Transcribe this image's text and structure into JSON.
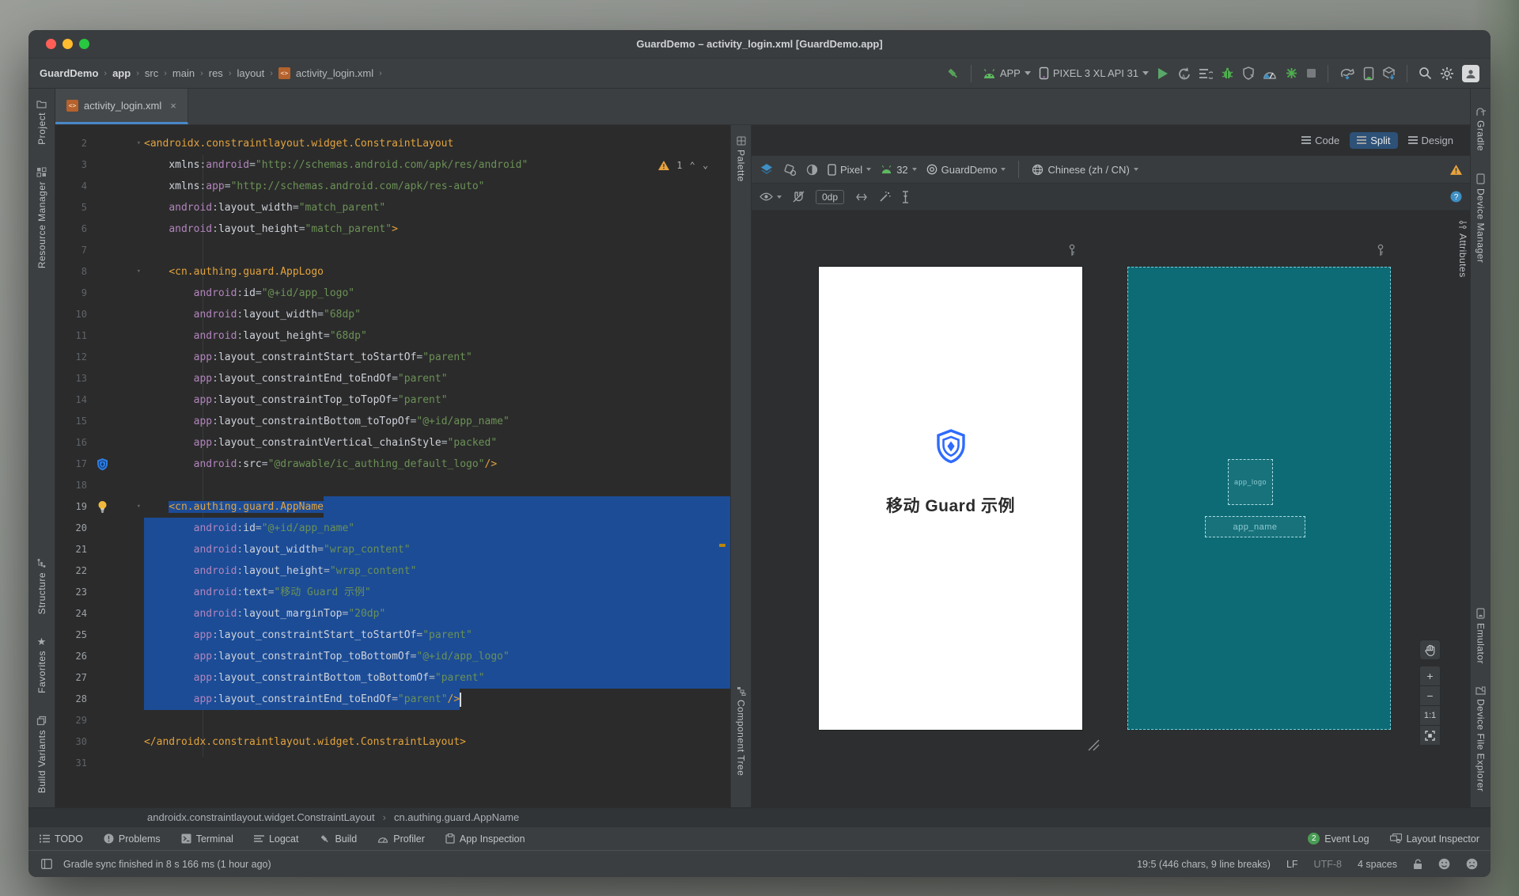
{
  "window": {
    "title": "GuardDemo – activity_login.xml [GuardDemo.app]"
  },
  "breadcrumb": {
    "items": [
      "GuardDemo",
      "app",
      "src",
      "main",
      "res",
      "layout",
      "activity_login.xml"
    ]
  },
  "toolbar": {
    "run_config": "APP",
    "device": "PIXEL 3 XL API 31",
    "action_icons": [
      "build-hammer",
      "android-head",
      "device-phone",
      "run",
      "apply-changes",
      "apply-code-changes",
      "debug",
      "profile",
      "profiler-gauge",
      "attach-debugger",
      "stop",
      "gradle-sync",
      "device-manager",
      "sdk-manager",
      "search",
      "settings",
      "avatar"
    ]
  },
  "tabs": {
    "active": "activity_login.xml"
  },
  "view_modes": {
    "code": "Code",
    "split": "Split",
    "design": "Design",
    "active": "Split"
  },
  "left_strip": {
    "top": [
      "Project",
      "Resource Manager"
    ],
    "bottom": [
      "Structure",
      "Favorites",
      "Build Variants"
    ]
  },
  "mid_strip": {
    "top": "Palette",
    "bottom": "Component Tree"
  },
  "right_strip": {
    "top": [
      "Gradle",
      "Device Manager"
    ],
    "bottom": [
      "Emulator",
      "Device File Explorer"
    ],
    "attributes_tab": "Attributes"
  },
  "editor": {
    "warning_count": "1",
    "selection_range": "lines 19-28",
    "lines": [
      {
        "n": "2",
        "sel": "none",
        "g": "fold",
        "t": [
          [
            "tag",
            "<androidx.constraintlayout.widget.ConstraintLayout"
          ]
        ]
      },
      {
        "n": "3",
        "sel": "none",
        "g": "",
        "t": [
          [
            "pln",
            "    "
          ],
          [
            "attr",
            "xmlns"
          ],
          [
            "pln",
            ":"
          ],
          [
            "ns",
            "android"
          ],
          [
            "pln",
            "="
          ],
          [
            "val",
            "\"http://schemas.android.com/apk/res/android\""
          ]
        ]
      },
      {
        "n": "4",
        "sel": "none",
        "g": "",
        "t": [
          [
            "pln",
            "    "
          ],
          [
            "attr",
            "xmlns"
          ],
          [
            "pln",
            ":"
          ],
          [
            "ns",
            "app"
          ],
          [
            "pln",
            "="
          ],
          [
            "val",
            "\"http://schemas.android.com/apk/res-auto\""
          ]
        ]
      },
      {
        "n": "5",
        "sel": "none",
        "g": "",
        "t": [
          [
            "pln",
            "    "
          ],
          [
            "ns",
            "android"
          ],
          [
            "pln",
            ":"
          ],
          [
            "attr",
            "layout_width"
          ],
          [
            "pln",
            "="
          ],
          [
            "val",
            "\"match_parent\""
          ]
        ]
      },
      {
        "n": "6",
        "sel": "none",
        "g": "",
        "t": [
          [
            "pln",
            "    "
          ],
          [
            "ns",
            "android"
          ],
          [
            "pln",
            ":"
          ],
          [
            "attr",
            "layout_height"
          ],
          [
            "pln",
            "="
          ],
          [
            "val",
            "\"match_parent\""
          ],
          [
            "tag",
            ">"
          ]
        ]
      },
      {
        "n": "7",
        "sel": "none",
        "g": "",
        "t": []
      },
      {
        "n": "8",
        "sel": "none",
        "g": "fold",
        "t": [
          [
            "pln",
            "    "
          ],
          [
            "tag",
            "<cn.authing.guard.AppLogo"
          ]
        ]
      },
      {
        "n": "9",
        "sel": "none",
        "g": "",
        "t": [
          [
            "pln",
            "        "
          ],
          [
            "ns",
            "android"
          ],
          [
            "pln",
            ":"
          ],
          [
            "attr",
            "id"
          ],
          [
            "pln",
            "="
          ],
          [
            "val",
            "\"@+id/app_logo\""
          ]
        ]
      },
      {
        "n": "10",
        "sel": "none",
        "g": "",
        "t": [
          [
            "pln",
            "        "
          ],
          [
            "ns",
            "android"
          ],
          [
            "pln",
            ":"
          ],
          [
            "attr",
            "layout_width"
          ],
          [
            "pln",
            "="
          ],
          [
            "val",
            "\"68dp\""
          ]
        ]
      },
      {
        "n": "11",
        "sel": "none",
        "g": "",
        "t": [
          [
            "pln",
            "        "
          ],
          [
            "ns",
            "android"
          ],
          [
            "pln",
            ":"
          ],
          [
            "attr",
            "layout_height"
          ],
          [
            "pln",
            "="
          ],
          [
            "val",
            "\"68dp\""
          ]
        ]
      },
      {
        "n": "12",
        "sel": "none",
        "g": "",
        "t": [
          [
            "pln",
            "        "
          ],
          [
            "ns",
            "app"
          ],
          [
            "pln",
            ":"
          ],
          [
            "attr",
            "layout_constraintStart_toStartOf"
          ],
          [
            "pln",
            "="
          ],
          [
            "val",
            "\"parent\""
          ]
        ]
      },
      {
        "n": "13",
        "sel": "none",
        "g": "",
        "t": [
          [
            "pln",
            "        "
          ],
          [
            "ns",
            "app"
          ],
          [
            "pln",
            ":"
          ],
          [
            "attr",
            "layout_constraintEnd_toEndOf"
          ],
          [
            "pln",
            "="
          ],
          [
            "val",
            "\"parent\""
          ]
        ]
      },
      {
        "n": "14",
        "sel": "none",
        "g": "",
        "t": [
          [
            "pln",
            "        "
          ],
          [
            "ns",
            "app"
          ],
          [
            "pln",
            ":"
          ],
          [
            "attr",
            "layout_constraintTop_toTopOf"
          ],
          [
            "pln",
            "="
          ],
          [
            "val",
            "\"parent\""
          ]
        ]
      },
      {
        "n": "15",
        "sel": "none",
        "g": "",
        "t": [
          [
            "pln",
            "        "
          ],
          [
            "ns",
            "app"
          ],
          [
            "pln",
            ":"
          ],
          [
            "attr",
            "layout_constraintBottom_toTopOf"
          ],
          [
            "pln",
            "="
          ],
          [
            "val",
            "\"@+id/app_name\""
          ]
        ]
      },
      {
        "n": "16",
        "sel": "none",
        "g": "",
        "t": [
          [
            "pln",
            "        "
          ],
          [
            "ns",
            "app"
          ],
          [
            "pln",
            ":"
          ],
          [
            "attr",
            "layout_constraintVertical_chainStyle"
          ],
          [
            "pln",
            "="
          ],
          [
            "val",
            "\"packed\""
          ]
        ]
      },
      {
        "n": "17",
        "sel": "none",
        "g": "shield",
        "t": [
          [
            "pln",
            "        "
          ],
          [
            "ns",
            "android"
          ],
          [
            "pln",
            ":"
          ],
          [
            "attr",
            "src"
          ],
          [
            "pln",
            "="
          ],
          [
            "val",
            "\"@drawable/ic_authing_default_logo\""
          ],
          [
            "tag",
            "/>"
          ]
        ]
      },
      {
        "n": "18",
        "sel": "none",
        "g": "",
        "t": []
      },
      {
        "n": "19",
        "sel": "tag",
        "g": "bulb",
        "t": [
          [
            "pln",
            "    "
          ],
          [
            "tag",
            "<cn.authing.guard.AppName"
          ]
        ]
      },
      {
        "n": "20",
        "sel": "full",
        "g": "",
        "t": [
          [
            "pln",
            "        "
          ],
          [
            "ns",
            "android"
          ],
          [
            "pln",
            ":"
          ],
          [
            "attr",
            "id"
          ],
          [
            "pln",
            "="
          ],
          [
            "val",
            "\"@+id/app_name\""
          ]
        ]
      },
      {
        "n": "21",
        "sel": "full",
        "g": "",
        "t": [
          [
            "pln",
            "        "
          ],
          [
            "ns",
            "android"
          ],
          [
            "pln",
            ":"
          ],
          [
            "attr",
            "layout_width"
          ],
          [
            "pln",
            "="
          ],
          [
            "val",
            "\"wrap_content\""
          ]
        ]
      },
      {
        "n": "22",
        "sel": "full",
        "g": "",
        "t": [
          [
            "pln",
            "        "
          ],
          [
            "ns",
            "android"
          ],
          [
            "pln",
            ":"
          ],
          [
            "attr",
            "layout_height"
          ],
          [
            "pln",
            "="
          ],
          [
            "val",
            "\"wrap_content\""
          ]
        ]
      },
      {
        "n": "23",
        "sel": "full",
        "g": "",
        "t": [
          [
            "pln",
            "        "
          ],
          [
            "ns",
            "android"
          ],
          [
            "pln",
            ":"
          ],
          [
            "attr",
            "text"
          ],
          [
            "pln",
            "="
          ],
          [
            "val",
            "\"移动 Guard 示例\""
          ]
        ]
      },
      {
        "n": "24",
        "sel": "full",
        "g": "",
        "t": [
          [
            "pln",
            "        "
          ],
          [
            "ns",
            "android"
          ],
          [
            "pln",
            ":"
          ],
          [
            "attr",
            "layout_marginTop"
          ],
          [
            "pln",
            "="
          ],
          [
            "val",
            "\"20dp\""
          ]
        ]
      },
      {
        "n": "25",
        "sel": "full",
        "g": "",
        "t": [
          [
            "pln",
            "        "
          ],
          [
            "ns",
            "app"
          ],
          [
            "pln",
            ":"
          ],
          [
            "attr",
            "layout_constraintStart_toStartOf"
          ],
          [
            "pln",
            "="
          ],
          [
            "val",
            "\"parent\""
          ]
        ]
      },
      {
        "n": "26",
        "sel": "full",
        "g": "",
        "t": [
          [
            "pln",
            "        "
          ],
          [
            "ns",
            "app"
          ],
          [
            "pln",
            ":"
          ],
          [
            "attr",
            "layout_constraintTop_toBottomOf"
          ],
          [
            "pln",
            "="
          ],
          [
            "val",
            "\"@+id/app_logo\""
          ]
        ]
      },
      {
        "n": "27",
        "sel": "full",
        "g": "",
        "t": [
          [
            "pln",
            "        "
          ],
          [
            "ns",
            "app"
          ],
          [
            "pln",
            ":"
          ],
          [
            "attr",
            "layout_constraintBottom_toBottomOf"
          ],
          [
            "pln",
            "="
          ],
          [
            "val",
            "\"parent\""
          ]
        ]
      },
      {
        "n": "28",
        "sel": "content",
        "g": "",
        "t": [
          [
            "pln",
            "        "
          ],
          [
            "ns",
            "app"
          ],
          [
            "pln",
            ":"
          ],
          [
            "attr",
            "layout_constraintEnd_toEndOf"
          ],
          [
            "pln",
            "="
          ],
          [
            "val",
            "\"parent\""
          ],
          [
            "tag",
            "/>"
          ]
        ]
      },
      {
        "n": "29",
        "sel": "none",
        "g": "",
        "t": []
      },
      {
        "n": "30",
        "sel": "none",
        "g": "",
        "t": [
          [
            "tag",
            "</androidx.constraintlayout.widget.ConstraintLayout>"
          ]
        ]
      },
      {
        "n": "31",
        "sel": "none",
        "g": "",
        "t": []
      }
    ]
  },
  "design": {
    "toolbar1": {
      "device": "Pixel",
      "api": "32",
      "theme": "GuardDemo",
      "locale": "Chinese (zh / CN)"
    },
    "toolbar2": {
      "default_margin": "0dp"
    },
    "preview": {
      "app_name": "移动 Guard 示例"
    },
    "blueprint": {
      "logo_label": "app_logo",
      "name_label": "app_name"
    },
    "zoom": {
      "one_to_one": "1:1"
    }
  },
  "xml_breadcrumb": {
    "items": [
      "androidx.constraintlayout.widget.ConstraintLayout",
      "cn.authing.guard.AppName"
    ]
  },
  "tool_windows": {
    "left": [
      "TODO",
      "Problems",
      "Terminal",
      "Logcat",
      "Build",
      "Profiler",
      "App Inspection"
    ],
    "event_log": {
      "badge": "2",
      "label": "Event Log"
    },
    "layout_inspector": {
      "label": "Layout Inspector"
    }
  },
  "status": {
    "message": "Gradle sync finished in 8 s 166 ms (1 hour ago)",
    "position": "19:5 (446 chars, 9 line breaks)",
    "line_separator": "LF",
    "encoding": "UTF-8",
    "indentation": "4 spaces"
  },
  "colors": {
    "accent_blue": "#4a88c7",
    "selection": "#1c4c96",
    "blueprint": "#0c6b75",
    "logo_blue": "#2f6bff",
    "warning_orange": "#e8a33d",
    "run_green": "#59a869"
  }
}
